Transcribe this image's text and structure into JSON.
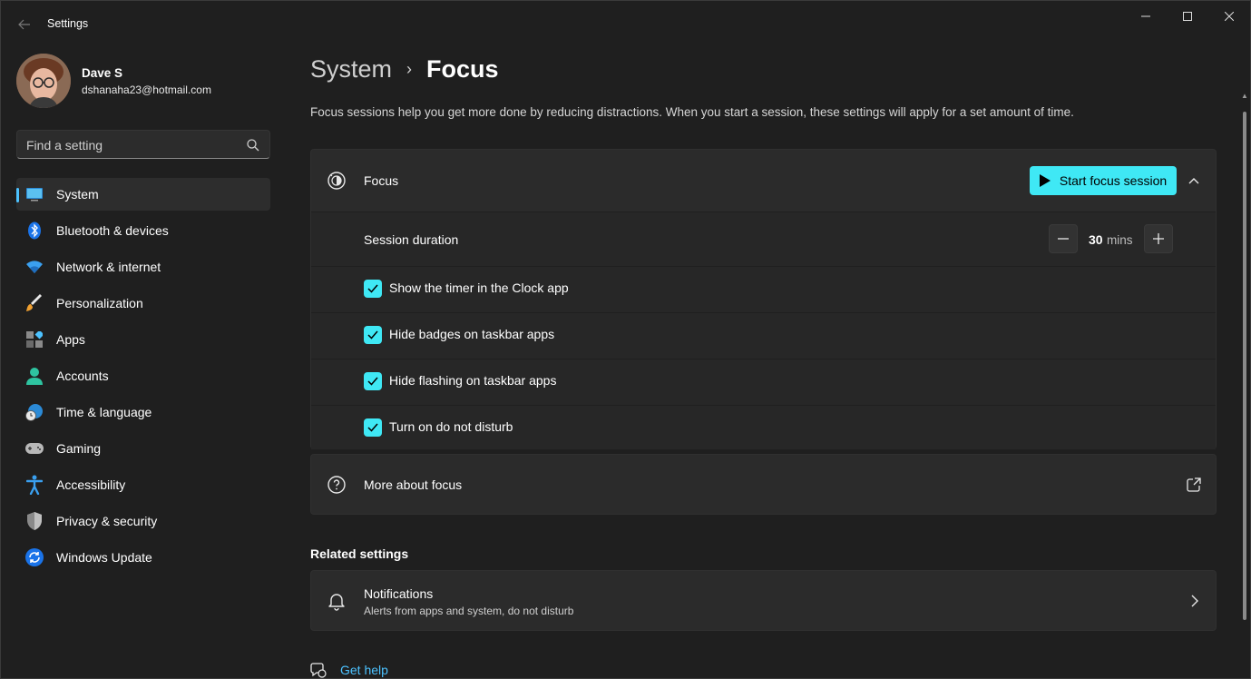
{
  "window": {
    "app_title": "Settings",
    "controls": [
      "minimize-icon",
      "maximize-icon",
      "close-icon"
    ]
  },
  "profile": {
    "name": "Dave S",
    "email": "dshanaha23@hotmail.com"
  },
  "search": {
    "placeholder": "Find a setting",
    "icon": "search-icon"
  },
  "sidebar": {
    "items": [
      {
        "label": "System",
        "icon": "system-icon",
        "active": true
      },
      {
        "label": "Bluetooth & devices",
        "icon": "bluetooth-icon"
      },
      {
        "label": "Network & internet",
        "icon": "wifi-icon"
      },
      {
        "label": "Personalization",
        "icon": "brush-icon"
      },
      {
        "label": "Apps",
        "icon": "apps-icon"
      },
      {
        "label": "Accounts",
        "icon": "person-icon"
      },
      {
        "label": "Time & language",
        "icon": "globe-clock-icon"
      },
      {
        "label": "Gaming",
        "icon": "gamepad-icon"
      },
      {
        "label": "Accessibility",
        "icon": "accessibility-icon"
      },
      {
        "label": "Privacy & security",
        "icon": "shield-icon"
      },
      {
        "label": "Windows Update",
        "icon": "update-icon"
      }
    ]
  },
  "page": {
    "breadcrumb_parent": "System",
    "breadcrumb_separator": "›",
    "title": "Focus",
    "description": "Focus sessions help you get more done by reducing distractions. When you start a session, these settings will apply for a set amount of time."
  },
  "focus": {
    "title": "Focus",
    "start_button": "Start focus session",
    "duration_label": "Session duration",
    "duration_value": "30",
    "duration_unit": "mins",
    "options": [
      {
        "label": "Show the timer in the Clock app",
        "checked": true
      },
      {
        "label": "Hide badges on taskbar apps",
        "checked": true
      },
      {
        "label": "Hide flashing on taskbar apps",
        "checked": true
      },
      {
        "label": "Turn on do not disturb",
        "checked": true
      }
    ]
  },
  "more": {
    "label": "More about focus"
  },
  "related": {
    "section_title": "Related settings",
    "notifications_title": "Notifications",
    "notifications_subtitle": "Alerts from apps and system, do not disturb"
  },
  "help": {
    "label": "Get help"
  },
  "colors": {
    "accent": "#3fe8f5",
    "link": "#4cc2ff",
    "background": "#1f1f1f",
    "card": "#2b2b2b"
  }
}
